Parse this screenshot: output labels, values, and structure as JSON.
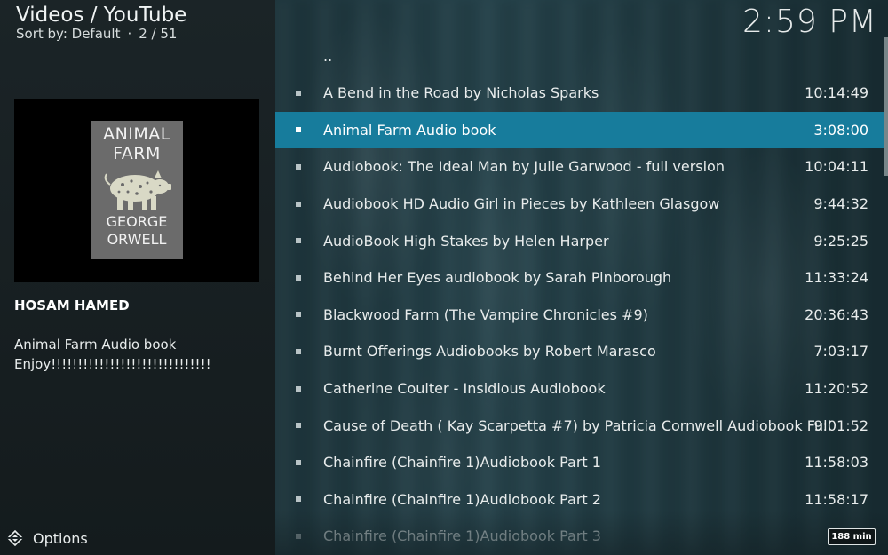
{
  "header": {
    "title": "Videos / YouTube",
    "sort_label": "Sort by: Default",
    "separator": "·",
    "position": "2 / 51",
    "clock": "2:59 PM"
  },
  "thumbnail": {
    "cover_title_line1": "ANIMAL",
    "cover_title_line2": "FARM",
    "cover_author_line1": "GEORGE",
    "cover_author_line2": "ORWELL"
  },
  "info": {
    "channel": "HOSAM HAMED",
    "description_line1": "Animal Farm Audio book",
    "description_line2": "Enjoy!!!!!!!!!!!!!!!!!!!!!!!!!!!!!!"
  },
  "footer": {
    "options_label": "Options",
    "duration_badge": "188 min"
  },
  "list": {
    "parent_label": "..",
    "items": [
      {
        "title": "A Bend in the Road by Nicholas Sparks",
        "duration": "10:14:49"
      },
      {
        "title": "Animal Farm Audio book",
        "duration": "3:08:00"
      },
      {
        "title": "Audiobook: The Ideal Man by Julie Garwood - full version",
        "duration": "10:04:11"
      },
      {
        "title": "Audiobook HD Audio Girl in Pieces by Kathleen Glasgow",
        "duration": "9:44:32"
      },
      {
        "title": "AudioBook High Stakes by Helen Harper",
        "duration": "9:25:25"
      },
      {
        "title": "Behind Her Eyes audiobook by Sarah Pinborough",
        "duration": "11:33:24"
      },
      {
        "title": "Blackwood Farm (The Vampire Chronicles #9)",
        "duration": "20:36:43"
      },
      {
        "title": "Burnt Offerings Audiobooks by Robert Marasco",
        "duration": "7:03:17"
      },
      {
        "title": "Catherine Coulter - Insidious Audiobook",
        "duration": "11:20:52"
      },
      {
        "title": "Cause of Death ( Kay Scarpetta #7) by Patricia Cornwell Audiobook Full",
        "duration": "9:01:52"
      },
      {
        "title": "Chainfire (Chainfire 1)Audiobook Part 1",
        "duration": "11:58:03"
      },
      {
        "title": "Chainfire (Chainfire 1)Audiobook Part 2",
        "duration": "11:58:17"
      },
      {
        "title": "Chainfire (Chainfire 1)Audiobook Part 3",
        "duration": ""
      }
    ]
  },
  "colors": {
    "selection": "#177c9c",
    "text": "#e8ecec"
  }
}
